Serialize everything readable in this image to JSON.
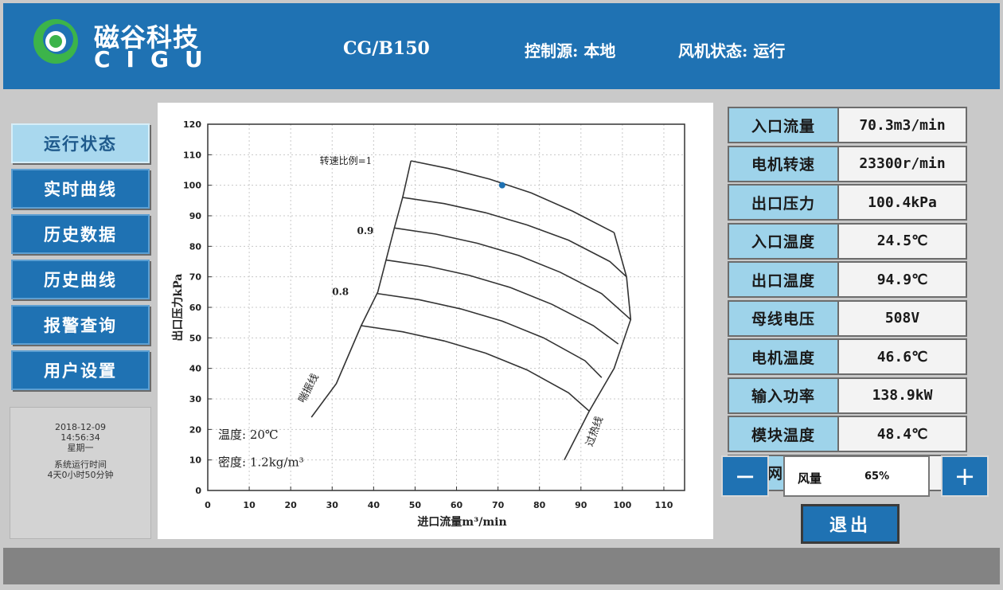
{
  "header": {
    "brand_cn": "磁谷科技",
    "brand_en": "CIGU",
    "model": "CG/B150",
    "control_source": "控制源: 本地",
    "fan_status": "风机状态: 运行",
    "colors": {
      "bar": "#1f72b3",
      "logo_green": "#3cb44a"
    }
  },
  "nav": {
    "items": [
      {
        "label": "运行状态",
        "active": true
      },
      {
        "label": "实时曲线",
        "active": false
      },
      {
        "label": "历史数据",
        "active": false
      },
      {
        "label": "历史曲线",
        "active": false
      },
      {
        "label": "报警查询",
        "active": false
      },
      {
        "label": "用户设置",
        "active": false
      }
    ]
  },
  "info": {
    "date": "2018-12-09",
    "time": "14:56:34",
    "weekday": "星期一",
    "runtime_label": "系统运行时间",
    "runtime_value": "4天0小时50分钟"
  },
  "chart_data": {
    "type": "line",
    "xlabel": "进口流量m³/min",
    "ylabel": "出口压力kPa",
    "xlim": [
      0,
      115
    ],
    "ylim": [
      0,
      120
    ],
    "x_ticks": [
      0,
      10,
      20,
      30,
      40,
      50,
      60,
      70,
      80,
      90,
      100,
      110
    ],
    "y_ticks": [
      0,
      10,
      20,
      30,
      40,
      50,
      60,
      70,
      80,
      90,
      100,
      110,
      120
    ],
    "grid": true,
    "series": [
      {
        "name": "转速比例=1",
        "x": [
          49,
          58,
          68,
          78,
          88,
          98
        ],
        "y": [
          108,
          105.5,
          102,
          97.5,
          91.5,
          84.5
        ]
      },
      {
        "x": [
          47,
          57,
          67,
          77,
          87,
          97,
          101
        ],
        "y": [
          96,
          94,
          91,
          87,
          82,
          75,
          70
        ]
      },
      {
        "name": "0.9",
        "x": [
          45,
          55,
          65,
          75,
          85,
          95,
          102
        ],
        "y": [
          86,
          84,
          81,
          77,
          71.5,
          64.5,
          56
        ]
      },
      {
        "x": [
          43,
          53,
          63,
          73,
          83,
          93,
          99
        ],
        "y": [
          75.5,
          73.5,
          70.5,
          66.5,
          61,
          54,
          48
        ]
      },
      {
        "name": "0.8",
        "x": [
          41,
          51,
          61,
          71,
          81,
          91,
          95
        ],
        "y": [
          64.5,
          62.5,
          59.5,
          55.5,
          50,
          42.5,
          37
        ]
      },
      {
        "x": [
          37,
          47,
          57,
          67,
          77,
          87,
          92
        ],
        "y": [
          54,
          52,
          49,
          45,
          39.5,
          32,
          26
        ]
      },
      {
        "name": "喘振线",
        "x": [
          25,
          31,
          37,
          41,
          45,
          47,
          49
        ],
        "y": [
          24,
          35,
          54,
          65,
          86,
          96,
          108
        ]
      },
      {
        "name": "过热线",
        "x": [
          98,
          101,
          102,
          98,
          92,
          86
        ],
        "y": [
          84.5,
          70,
          56,
          40,
          26,
          10
        ]
      }
    ],
    "operating_point": {
      "x": 71,
      "y": 100
    },
    "annotations": [
      {
        "text": "转速比例=1"
      },
      {
        "text": "0.9"
      },
      {
        "text": "0.8"
      },
      {
        "text": "喘振线"
      },
      {
        "text": "过热线"
      },
      {
        "text": "温度: 20℃"
      },
      {
        "text": "密度: 1.2kg/m³"
      }
    ]
  },
  "params": [
    {
      "label": "入口流量",
      "value": "70.3m3/min"
    },
    {
      "label": "电机转速",
      "value": "23300r/min"
    },
    {
      "label": "出口压力",
      "value": "100.4kPa"
    },
    {
      "label": "入口温度",
      "value": "24.5℃"
    },
    {
      "label": "出口温度",
      "value": "94.9℃"
    },
    {
      "label": "母线电压",
      "value": "508V"
    },
    {
      "label": "电机温度",
      "value": "46.6℃"
    },
    {
      "label": "输入功率",
      "value": "138.9kW"
    },
    {
      "label": "模块温度",
      "value": "48.4℃"
    },
    {
      "label": "滤网状态",
      "value": "",
      "indicator_color": "#6ec233"
    }
  ],
  "controls": {
    "minus": "−",
    "plus": "+",
    "fan_label": "风量",
    "fan_value": "65%",
    "exit": "退出"
  }
}
